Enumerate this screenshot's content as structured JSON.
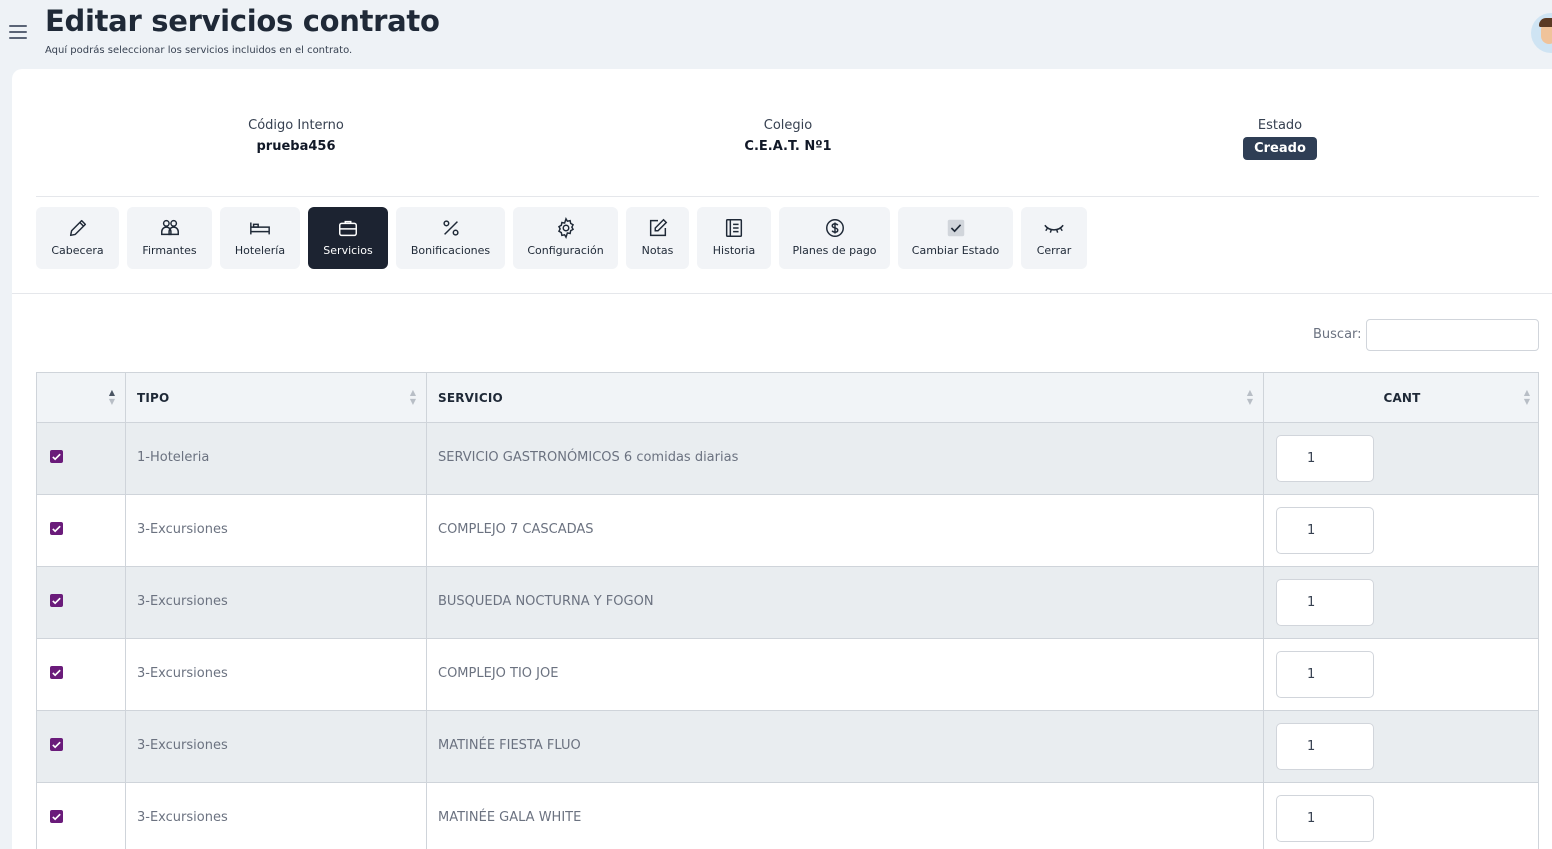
{
  "header": {
    "title": "Editar servicios contrato",
    "subtitle": "Aquí podrás seleccionar los servicios incluidos en el contrato."
  },
  "info": {
    "codigo_label": "Código Interno",
    "codigo_value": "prueba456",
    "colegio_label": "Colegio",
    "colegio_value": "C.E.A.T. Nº1",
    "estado_label": "Estado",
    "estado_value": "Creado"
  },
  "tabs": [
    {
      "label": "Cabecera",
      "icon": "pencil-icon"
    },
    {
      "label": "Firmantes",
      "icon": "users-icon"
    },
    {
      "label": "Hotelería",
      "icon": "bed-icon"
    },
    {
      "label": "Servicios",
      "icon": "briefcase-icon",
      "active": true
    },
    {
      "label": "Bonificaciones",
      "icon": "percent-icon"
    },
    {
      "label": "Configuración",
      "icon": "gear-icon"
    },
    {
      "label": "Notas",
      "icon": "edit-note-icon"
    },
    {
      "label": "Historia",
      "icon": "journal-icon"
    },
    {
      "label": "Planes de pago",
      "icon": "dollar-circle-icon"
    },
    {
      "label": "Cambiar Estado",
      "icon": "check-square-icon"
    },
    {
      "label": "Cerrar",
      "icon": "eye-closed-icon"
    }
  ],
  "search": {
    "label": "Buscar:",
    "value": ""
  },
  "table": {
    "headers": [
      "",
      "TIPO",
      "SERVICIO",
      "CANT"
    ],
    "rows": [
      {
        "checked": true,
        "tipo": "1-Hoteleria",
        "servicio": "SERVICIO GASTRONÓMICOS 6 comidas diarias",
        "cant": "1"
      },
      {
        "checked": true,
        "tipo": "3-Excursiones",
        "servicio": "COMPLEJO 7 CASCADAS",
        "cant": "1"
      },
      {
        "checked": true,
        "tipo": "3-Excursiones",
        "servicio": "BUSQUEDA NOCTURNA Y FOGON",
        "cant": "1"
      },
      {
        "checked": true,
        "tipo": "3-Excursiones",
        "servicio": "COMPLEJO TIO JOE",
        "cant": "1"
      },
      {
        "checked": true,
        "tipo": "3-Excursiones",
        "servicio": "MATINÉE FIESTA FLUO",
        "cant": "1"
      },
      {
        "checked": true,
        "tipo": "3-Excursiones",
        "servicio": "MATINÉE GALA WHITE",
        "cant": "1"
      }
    ]
  },
  "colors": {
    "accent_dark": "#1c2331",
    "badge": "#2f3e55",
    "checkbox": "#6a1b7a",
    "row_stripe": "#e9edf0",
    "page_bg": "#eef2f6"
  }
}
